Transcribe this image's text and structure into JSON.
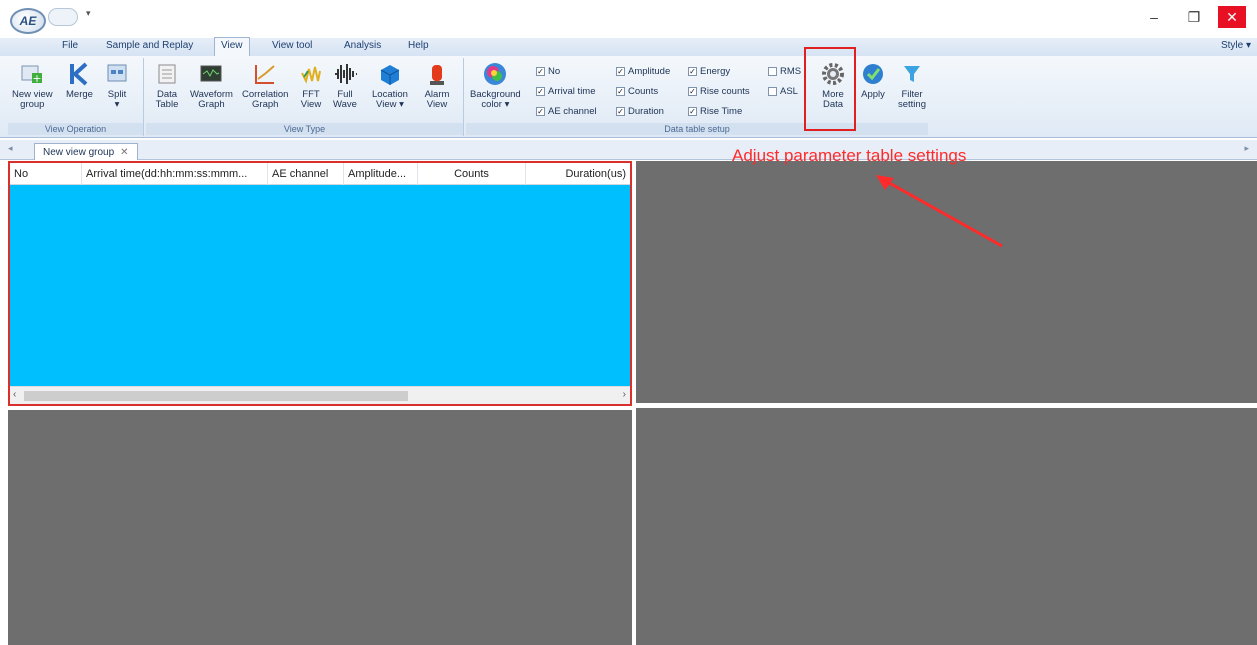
{
  "window": {
    "app_badge": "AE",
    "minimize": "–",
    "restore": "❐",
    "close": "✕"
  },
  "menu": {
    "items": [
      "File",
      "Sample and Replay",
      "View",
      "View tool",
      "Analysis",
      "Help"
    ],
    "active": "View",
    "style": "Style ▾"
  },
  "ribbon": {
    "view_operation": {
      "label": "View Operation",
      "buttons": [
        "New view\ngroup",
        "Merge",
        "Split\n▾"
      ]
    },
    "view_type": {
      "label": "View Type",
      "buttons": [
        "Data\nTable",
        "Waveform\nGraph",
        "Correlation\nGraph",
        "FFT\nView",
        "Full\nWave",
        "Location\nView ▾",
        "Alarm\nView"
      ]
    },
    "data_table_setup": {
      "label": "Data table setup",
      "background_color": "Background\ncolor ▾",
      "checks": [
        {
          "label": "No",
          "checked": true
        },
        {
          "label": "Arrival time",
          "checked": true
        },
        {
          "label": "AE channel",
          "checked": true
        },
        {
          "label": "Amplitude",
          "checked": true
        },
        {
          "label": "Counts",
          "checked": true
        },
        {
          "label": "Duration",
          "checked": true
        },
        {
          "label": "Energy",
          "checked": true
        },
        {
          "label": "Rise counts",
          "checked": true
        },
        {
          "label": "Rise Time",
          "checked": true
        },
        {
          "label": "RMS",
          "checked": false
        },
        {
          "label": "ASL",
          "checked": false
        }
      ],
      "more_data": "More\nData",
      "apply": "Apply",
      "filter_setting": "Filter\nsetting"
    }
  },
  "tabs": {
    "doc_tab": "New view group",
    "close": "✕"
  },
  "table": {
    "columns": [
      "No",
      "Arrival time(dd:hh:mm:ss:mmm...",
      "AE channel",
      "Amplitude...",
      "Counts",
      "Duration(us)"
    ],
    "body_color": "#00bfff"
  },
  "annotation": {
    "text": "Adjust parameter table settings",
    "color": "#ff2a2a"
  }
}
